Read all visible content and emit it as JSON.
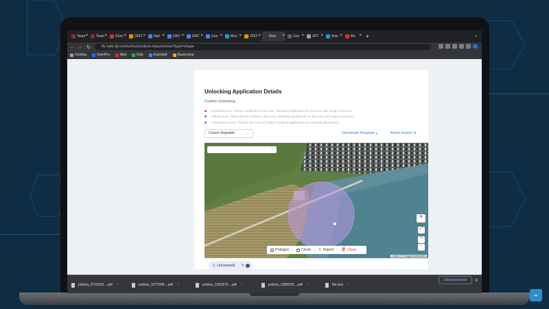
{
  "tabs": [
    {
      "label": "Team",
      "color": "#8a2b3a"
    },
    {
      "label": "Team",
      "color": "#8a2b3a"
    },
    {
      "label": "(Goo",
      "color": "#d93025"
    },
    {
      "label": "2023",
      "color": "#f28b00"
    },
    {
      "label": "Nejl",
      "color": "#4285f4"
    },
    {
      "label": "DRC",
      "color": "#4285f4"
    },
    {
      "label": "DRC",
      "color": "#4285f4"
    },
    {
      "label": "Goo",
      "color": "#4285f4"
    },
    {
      "label": "Mon",
      "color": "#1a9bd7"
    },
    {
      "label": "2023",
      "color": "#f28b00"
    },
    {
      "label": "New",
      "color": "#35363a",
      "active": true
    },
    {
      "label": "Geo",
      "color": "#5f6368"
    },
    {
      "label": "3D?",
      "color": "#9aa0a6"
    },
    {
      "label": "Actu",
      "color": "#1a9bd7"
    },
    {
      "label": "file",
      "color": "#d93025"
    }
  ],
  "url": "fly-safe.dji.com/unlock/unlock-request/new?type=shape",
  "bookmarks": [
    {
      "label": "Osobka",
      "color": "#9aa0a6"
    },
    {
      "label": "DronPro",
      "color": "#1a73e8"
    },
    {
      "label": "Mail",
      "color": "#d93025"
    },
    {
      "label": "Disk",
      "color": "#34a853"
    },
    {
      "label": "Kalendář",
      "color": "#4285f4"
    },
    {
      "label": "Basecamp",
      "color": "#f5a623"
    }
  ],
  "page": {
    "title": "Unlocking Application Details",
    "subtitle": "Custom Unlocking",
    "zones": [
      {
        "text": "Restricted Zone: Flying is prohibited in this zone. Unlocking applications for this zone take longer to process.",
        "color": "#e0443a"
      },
      {
        "text": "Altitude Zone: Flight altitude is limited in this zone. Unlocking applications for this zone take longer to process.",
        "color": "#9b59b6"
      },
      {
        "text": "Authorization Zone: Flying in this zone is limited. Unlocking applications are automatically granted.",
        "color": "#2e86de"
      }
    ],
    "country": "Czech Republic",
    "download_template": "Download Template",
    "batch_import": "Batch Import",
    "map": {
      "search_placeholder": "",
      "toolbar": {
        "polygon": "Polygon",
        "circle": "Circle",
        "import": "Import",
        "clear": "Clear"
      },
      "attribution": "Leaflet | © Google contributors"
    },
    "unnamed_chip": "1. Unnamed1"
  },
  "downloads": [
    {
      "name": "priloha_9716093....pdf"
    },
    {
      "name": "priloha_1077008....pdf"
    },
    {
      "name": "priloha_1002879....pdf"
    },
    {
      "name": "priloha_1068320....pdf"
    },
    {
      "name": "file.xlsx"
    }
  ],
  "downloads_show_all": "Zobrazovat vše"
}
